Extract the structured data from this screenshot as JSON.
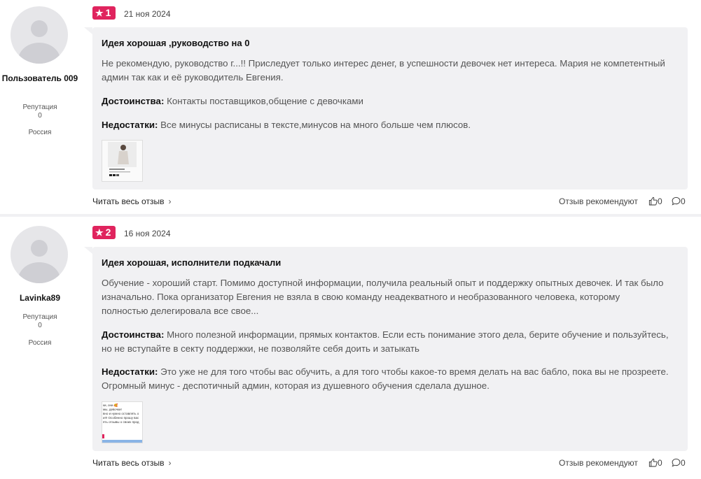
{
  "reviews": [
    {
      "user": {
        "name": "Пользователь 009",
        "reputation_label": "Репутация",
        "reputation": "0",
        "country": "Россия"
      },
      "rating": "1",
      "date": "21 ноя 2024",
      "title": "Идея хорошая ,руководство на 0",
      "body": "Не рекомендую, руководство г...!! Приследует только интерес денег, в успешности девочек нет интереса. Мария не компетентный админ так как и её руководитель Евгения.",
      "pros_label": "Достоинства:",
      "pros": "Контакты поставщиков,общение с девочками",
      "cons_label": "Недостатки:",
      "cons": "Все минусы расписаны в тексте,минусов на много больше чем плюсов.",
      "read_more": "Читать весь отзыв",
      "recommend_label": "Отзыв рекомендуют",
      "likes": "0",
      "comments": "0"
    },
    {
      "user": {
        "name": "Lavinka89",
        "reputation_label": "Репутация",
        "reputation": "0",
        "country": "Россия"
      },
      "rating": "2",
      "date": "16 ноя 2024",
      "title": "Идея хорошая, исполнители подкачали",
      "body": "Обучение - хороший старт. Помимо доступной информации, получила реальный опыт и поддержку опытных девочек. И так было изначально. Пока организатор Евгения не взяла в свою команду неадекватного и необразованного человека, которому полностью делегировала все свое...",
      "pros_label": "Достоинства:",
      "pros": "Много полезной информации, прямых контактов. Если есть понимание этого дела, берите обучение и пользуйтесь, но не вступайте в секту поддержки, не позволяйте себя доить и затыкать",
      "cons_label": "Недостатки:",
      "cons": "Это уже не для того чтобы вас обучить, а для того чтобы какое-то время делать на вас бабло, пока вы не прозреете. Огромный минус - деспотичный админ, которая из душевного обучения сделала душное.",
      "thumb_text": "ки, они 🥰\nмы, девочки!\nвно и нужно оставлять о\nи!!! Особенно прошу вас\nять отзывы о своих прод",
      "read_more": "Читать весь отзыв",
      "recommend_label": "Отзыв рекомендуют",
      "likes": "0",
      "comments": "0"
    }
  ],
  "colors": {
    "rating_badge": "#e0245e",
    "card_bg": "#f1f1f3"
  },
  "icons": {
    "rating": "star-icon",
    "read_more": "chevron-right-icon",
    "likes": "thumbs-up-icon",
    "comments": "comment-icon",
    "avatar": "user-avatar-placeholder"
  }
}
